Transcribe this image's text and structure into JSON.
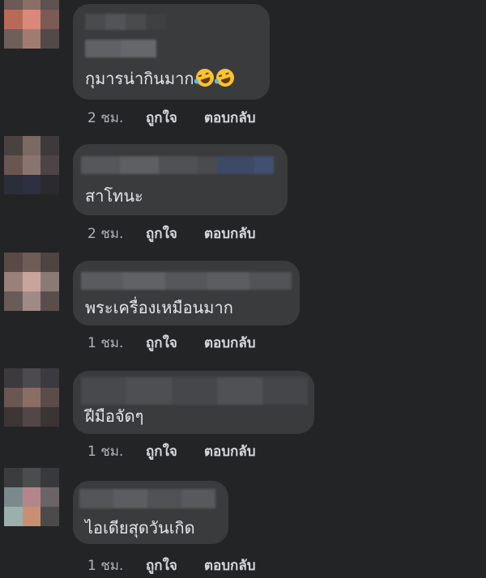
{
  "comments": [
    {
      "text": "กุมารน่ากินมาก",
      "emoji_icons": [
        "rofl-emoji-icon",
        "rofl-emoji-icon"
      ],
      "time": "2 ชม.",
      "like_label": "ถูกใจ",
      "reply_label": "ตอบกลับ"
    },
    {
      "text": "สาโทนะ",
      "time": "2 ชม.",
      "like_label": "ถูกใจ",
      "reply_label": "ตอบกลับ"
    },
    {
      "text": "พระเครื่องเหมือนมาก",
      "time": "1 ชม.",
      "like_label": "ถูกใจ",
      "reply_label": "ตอบกลับ"
    },
    {
      "text": "ฝีมือจัดๆ",
      "time": "1 ชม.",
      "like_label": "ถูกใจ",
      "reply_label": "ตอบกลับ"
    },
    {
      "text": "ไอเดียสุดวันเกิด",
      "time": "1 ชม.",
      "like_label": "ถูกใจ",
      "reply_label": "ตอบกลับ"
    }
  ],
  "colors": {
    "background": "#232426",
    "bubble": "#3a3b3c",
    "comment_text": "#e4e6eb",
    "meta_text": "#b0b3b8"
  }
}
